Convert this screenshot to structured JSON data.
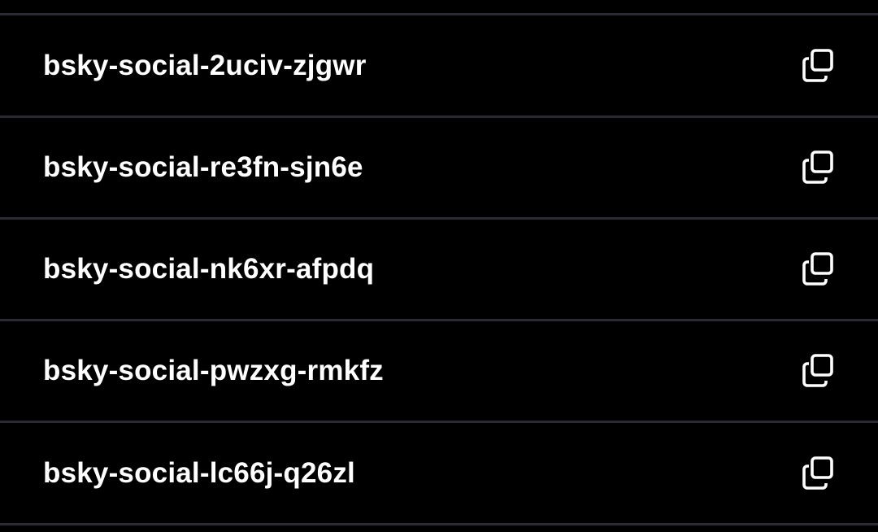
{
  "colors": {
    "background": "#000000",
    "divider": "#2a2b32",
    "text": "#ffffff"
  },
  "invite_codes": [
    {
      "code": "bsky-social-2uciv-zjgwr",
      "icon": "copy-icon"
    },
    {
      "code": "bsky-social-re3fn-sjn6e",
      "icon": "copy-icon"
    },
    {
      "code": "bsky-social-nk6xr-afpdq",
      "icon": "copy-icon"
    },
    {
      "code": "bsky-social-pwzxg-rmkfz",
      "icon": "copy-icon"
    },
    {
      "code": "bsky-social-lc66j-q26zl",
      "icon": "copy-icon"
    }
  ]
}
